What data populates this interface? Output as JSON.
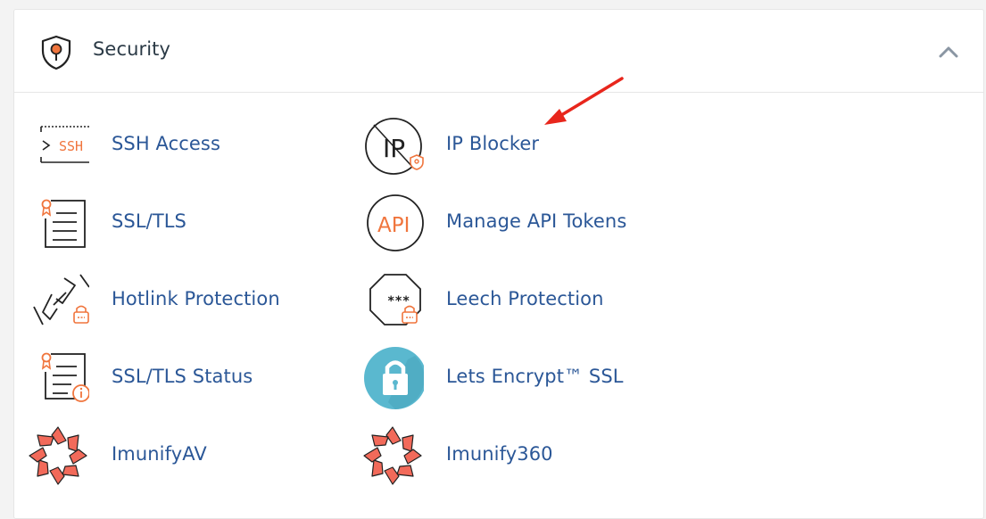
{
  "section": {
    "title": "Security",
    "header_icon": "shield-icon",
    "collapse_icon": "chevron-up-icon"
  },
  "items": [
    {
      "label": "SSH Access",
      "icon": "ssh-terminal-icon"
    },
    {
      "label": "IP Blocker",
      "icon": "ip-blocker-icon"
    },
    {
      "label": "SSL/TLS",
      "icon": "certificate-icon"
    },
    {
      "label": "Manage API Tokens",
      "icon": "api-icon"
    },
    {
      "label": "Hotlink Protection",
      "icon": "hotlink-chain-icon"
    },
    {
      "label": "Leech Protection",
      "icon": "leech-octagon-icon"
    },
    {
      "label": "SSL/TLS Status",
      "icon": "certificate-status-icon"
    },
    {
      "label": "Lets Encrypt™ SSL",
      "icon": "padlock-icon"
    },
    {
      "label": "ImunifyAV",
      "icon": "imunify-icon"
    },
    {
      "label": "Imunify360",
      "icon": "imunify-icon"
    }
  ],
  "icon_text": {
    "ssh": "SSH",
    "ip": "IP",
    "api": "API",
    "leech": "***"
  },
  "colors": {
    "link": "#2b5797",
    "accent": "#f0753d",
    "annotation_arrow": "#e8261c",
    "padlock_bg": "#5ab8cf"
  }
}
